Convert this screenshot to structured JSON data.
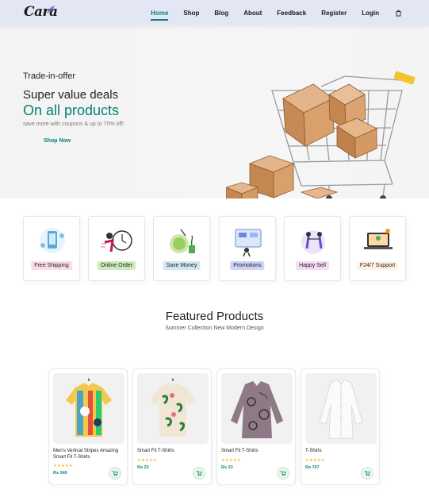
{
  "brand": {
    "logo_text": "Cara"
  },
  "nav": {
    "items": [
      {
        "label": "Home",
        "active": true
      },
      {
        "label": "Shop"
      },
      {
        "label": "Blog"
      },
      {
        "label": "About"
      },
      {
        "label": "Feedback"
      },
      {
        "label": "Register"
      },
      {
        "label": "Login"
      }
    ],
    "cart_icon": "shopping-bag-icon"
  },
  "hero": {
    "eyebrow": "Trade-in-offer",
    "title_line1": "Super value deals",
    "title_line2": "On all products",
    "subtitle": "save more with coupons & up to 70% off!",
    "cta": "Shop Now"
  },
  "features": [
    {
      "label": "Free Shipping",
      "bg": "#fddde4"
    },
    {
      "label": "Online Order",
      "bg": "#cdebbc"
    },
    {
      "label": "Save Money",
      "bg": "#d1e8f2"
    },
    {
      "label": "Promotions",
      "bg": "#cdd4f8"
    },
    {
      "label": "Happy Sell",
      "bg": "#f6dbf6"
    },
    {
      "label": "F24/7 Support",
      "bg": "#fff2e5"
    }
  ],
  "featured": {
    "title": "Featured Products",
    "subtitle": "Summer Collection New Modern Design",
    "products": [
      {
        "name": "Men's Vertical Stripes Amazing Smart Fit T-Shirts",
        "stars": "★★★★★",
        "price": "Rs 340"
      },
      {
        "name": "Smart Fit T-Shirts",
        "stars": "★★★★★",
        "price": "Rs 23"
      },
      {
        "name": "Smart Fit T-Shirts",
        "stars": "★★★★★",
        "price": "Rs 23"
      },
      {
        "name": "T-Shirts",
        "stars": "★★★★★",
        "price": "Rs 767"
      }
    ]
  },
  "colors": {
    "accent": "#088178",
    "header_bg": "#e3e6f3",
    "star": "#f3b51b"
  }
}
